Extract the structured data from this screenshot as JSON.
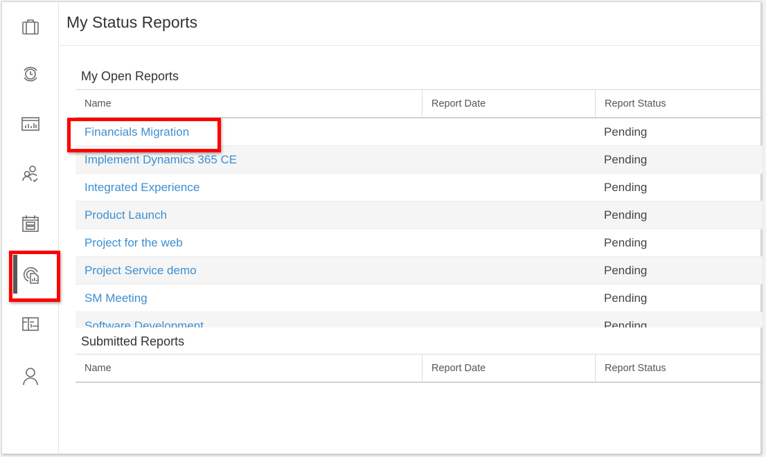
{
  "sidebar": {
    "items": [
      {
        "id": "projects",
        "icon": "briefcase-icon"
      },
      {
        "id": "time",
        "icon": "clock-icon"
      },
      {
        "id": "reports",
        "icon": "chart-icon"
      },
      {
        "id": "resources",
        "icon": "people-check-icon"
      },
      {
        "id": "schedule",
        "icon": "calendar-icon"
      },
      {
        "id": "status-reports",
        "icon": "status-report-icon",
        "active": true
      },
      {
        "id": "board",
        "icon": "board-icon"
      },
      {
        "id": "profile",
        "icon": "person-icon"
      }
    ]
  },
  "header": {
    "title": "My Status Reports"
  },
  "open_reports": {
    "title": "My Open Reports",
    "columns": [
      "Name",
      "Report Date",
      "Report Status"
    ],
    "rows": [
      {
        "name": "Financials Migration",
        "date": "",
        "status": "Pending"
      },
      {
        "name": "Implement Dynamics 365 CE",
        "date": "",
        "status": "Pending"
      },
      {
        "name": "Integrated Experience",
        "date": "",
        "status": "Pending"
      },
      {
        "name": "Product Launch",
        "date": "",
        "status": "Pending"
      },
      {
        "name": "Project for the web",
        "date": "",
        "status": "Pending"
      },
      {
        "name": "Project Service demo",
        "date": "",
        "status": "Pending"
      },
      {
        "name": "SM Meeting",
        "date": "",
        "status": "Pending"
      },
      {
        "name": "Software Development",
        "date": "",
        "status": "Pending"
      }
    ]
  },
  "submitted_reports": {
    "title": "Submitted Reports",
    "columns": [
      "Name",
      "Report Date",
      "Report Status"
    ],
    "rows": []
  },
  "colors": {
    "link": "#3d8fd1",
    "highlight": "#ff0000",
    "active_bar": "#505a60"
  }
}
